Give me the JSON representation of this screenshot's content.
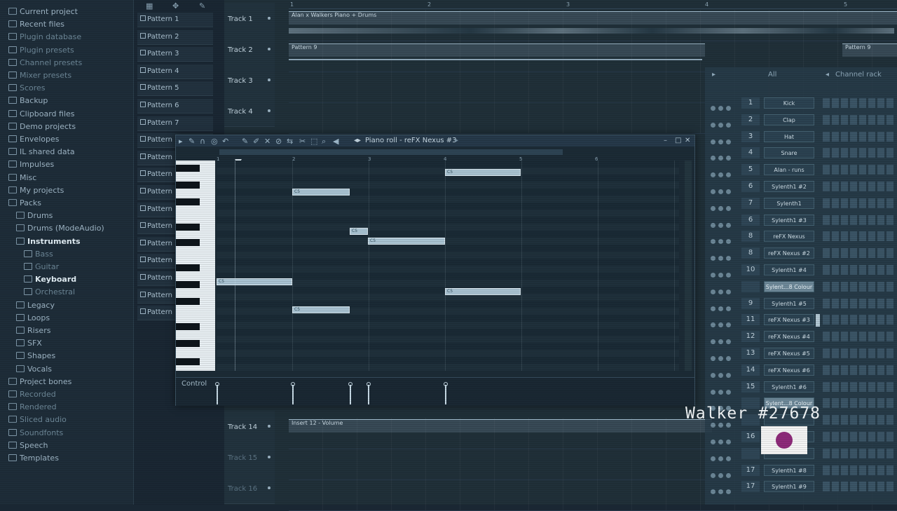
{
  "browser": {
    "items": [
      {
        "label": "Current project",
        "cls": "bitem",
        "indent": 0
      },
      {
        "label": "Recent files",
        "cls": "bitem",
        "indent": 0
      },
      {
        "label": "Plugin database",
        "cls": "bitem dim",
        "indent": 0
      },
      {
        "label": "Plugin presets",
        "cls": "bitem dim",
        "indent": 0
      },
      {
        "label": "Channel presets",
        "cls": "bitem dim",
        "indent": 0
      },
      {
        "label": "Mixer presets",
        "cls": "bitem dim",
        "indent": 0
      },
      {
        "label": "Scores",
        "cls": "bitem dim",
        "indent": 0
      },
      {
        "label": "Backup",
        "cls": "bitem",
        "indent": 0
      },
      {
        "label": "Clipboard files",
        "cls": "bitem",
        "indent": 0
      },
      {
        "label": "Demo projects",
        "cls": "bitem",
        "indent": 0
      },
      {
        "label": "Envelopes",
        "cls": "bitem",
        "indent": 0
      },
      {
        "label": "IL shared data",
        "cls": "bitem",
        "indent": 0
      },
      {
        "label": "Impulses",
        "cls": "bitem",
        "indent": 0
      },
      {
        "label": "Misc",
        "cls": "bitem",
        "indent": 0
      },
      {
        "label": "My projects",
        "cls": "bitem",
        "indent": 0
      },
      {
        "label": "Packs",
        "cls": "bitem",
        "indent": 0
      },
      {
        "label": "Drums",
        "cls": "bitem",
        "indent": 1
      },
      {
        "label": "Drums (ModeAudio)",
        "cls": "bitem",
        "indent": 1
      },
      {
        "label": "Instruments",
        "cls": "bitem bright",
        "indent": 1
      },
      {
        "label": "Bass",
        "cls": "bitem dim",
        "indent": 2
      },
      {
        "label": "Guitar",
        "cls": "bitem dim",
        "indent": 2
      },
      {
        "label": "Keyboard",
        "cls": "bitem bright",
        "indent": 2
      },
      {
        "label": "Orchestral",
        "cls": "bitem dim",
        "indent": 2
      },
      {
        "label": "Legacy",
        "cls": "bitem",
        "indent": 1
      },
      {
        "label": "Loops",
        "cls": "bitem",
        "indent": 1
      },
      {
        "label": "Risers",
        "cls": "bitem",
        "indent": 1
      },
      {
        "label": "SFX",
        "cls": "bitem",
        "indent": 1
      },
      {
        "label": "Shapes",
        "cls": "bitem",
        "indent": 1
      },
      {
        "label": "Vocals",
        "cls": "bitem",
        "indent": 1
      },
      {
        "label": "Project bones",
        "cls": "bitem",
        "indent": 0
      },
      {
        "label": "Recorded",
        "cls": "bitem dim",
        "indent": 0
      },
      {
        "label": "Rendered",
        "cls": "bitem dim",
        "indent": 0
      },
      {
        "label": "Sliced audio",
        "cls": "bitem dim",
        "indent": 0
      },
      {
        "label": "Soundfonts",
        "cls": "bitem dim",
        "indent": 0
      },
      {
        "label": "Speech",
        "cls": "bitem",
        "indent": 0
      },
      {
        "label": "Templates",
        "cls": "bitem",
        "indent": 0
      }
    ]
  },
  "patterns": [
    "Pattern 1",
    "Pattern 2",
    "Pattern 3",
    "Pattern 4",
    "Pattern 5",
    "Pattern 6",
    "Pattern 7",
    "Pattern",
    "Pattern",
    "Pattern",
    "Pattern",
    "Pattern",
    "Pattern",
    "Pattern",
    "Pattern",
    "Pattern",
    "Pattern",
    "Pattern"
  ],
  "playlist": {
    "ruler": [
      "1",
      "2",
      "3",
      "4",
      "5"
    ],
    "tracks": [
      "Track 1",
      "Track 2",
      "Track 3",
      "Track 4"
    ],
    "track14": "Track 14",
    "track15": "Track 15",
    "track16": "Track 16",
    "clip_track1": "Alan x Walkers Piano + Drums",
    "clip_track2": "Pattern 9",
    "clip_track2_end": "Pattern 9",
    "clip_track14": "Insert 12 - Volume"
  },
  "pianoroll": {
    "title": "Piano roll - reFX Nexus #3",
    "ruler": [
      "1",
      "2",
      "3",
      "4",
      "5",
      "6"
    ],
    "control_label": "Control",
    "note_text": "C5"
  },
  "rack": {
    "filter": "All",
    "title": "Channel rack",
    "channels": [
      {
        "num": "1",
        "name": "Kick"
      },
      {
        "num": "2",
        "name": "Clap"
      },
      {
        "num": "3",
        "name": "Hat"
      },
      {
        "num": "4",
        "name": "Snare"
      },
      {
        "num": "5",
        "name": "Alan - runs"
      },
      {
        "num": "6",
        "name": "Sylenth1 #2"
      },
      {
        "num": "7",
        "name": "Sylenth1"
      },
      {
        "num": "6",
        "name": "Sylenth1 #3"
      },
      {
        "num": "8",
        "name": "reFX Nexus"
      },
      {
        "num": "8",
        "name": "reFX Nexus #2"
      },
      {
        "num": "10",
        "name": "Sylenth1 #4"
      },
      {
        "num": "",
        "name": "Sylent...8 Colour",
        "hl": true
      },
      {
        "num": "9",
        "name": "Sylenth1 #5"
      },
      {
        "num": "11",
        "name": "reFX Nexus #3"
      },
      {
        "num": "12",
        "name": "reFX Nexus #4"
      },
      {
        "num": "13",
        "name": "reFX Nexus #5"
      },
      {
        "num": "14",
        "name": "reFX Nexus #6"
      },
      {
        "num": "15",
        "name": "Sylenth1 #6"
      },
      {
        "num": "",
        "name": "Sylent...8 Colour",
        "hl": true
      },
      {
        "num": "",
        "name": ""
      },
      {
        "num": "16",
        "name": ""
      },
      {
        "num": "",
        "name": ""
      },
      {
        "num": "17",
        "name": "Sylenth1 #8"
      },
      {
        "num": "17",
        "name": "Sylenth1 #9"
      }
    ]
  },
  "watermark": "Walker #27678"
}
